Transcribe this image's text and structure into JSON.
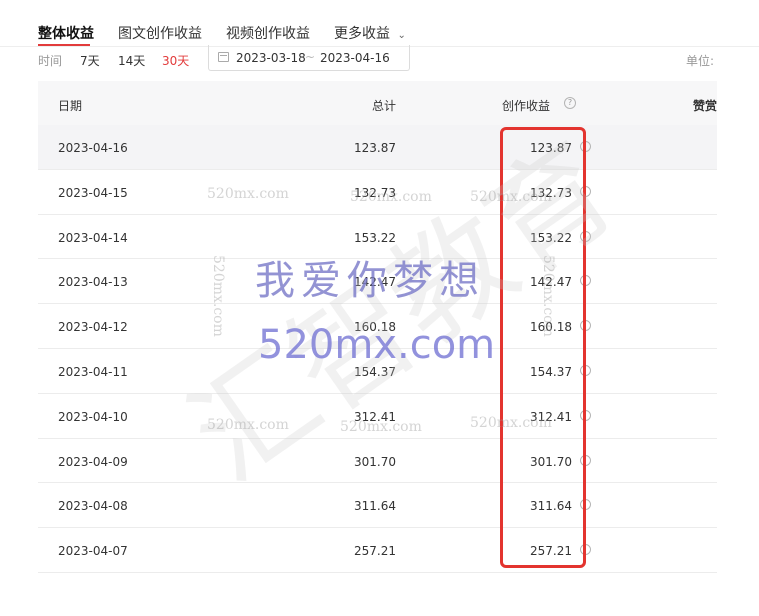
{
  "tabs": [
    {
      "label": "整体收益",
      "active": true
    },
    {
      "label": "图文创作收益",
      "active": false
    },
    {
      "label": "视频创作收益",
      "active": false
    },
    {
      "label": "更多收益",
      "active": false
    }
  ],
  "filter": {
    "label": "时间",
    "options": [
      "7天",
      "14天",
      "30天"
    ],
    "active_option": "30天",
    "date_start": "2023-03-18",
    "date_separator": "~",
    "date_end": "2023-04-16",
    "unit_label": "单位:"
  },
  "table": {
    "headers": {
      "date": "日期",
      "total": "总计",
      "earnings": "创作收益",
      "likes": "赞赏"
    },
    "rows": [
      {
        "date": "2023-04-16",
        "total": "123.87",
        "earnings": "123.87"
      },
      {
        "date": "2023-04-15",
        "total": "132.73",
        "earnings": "132.73"
      },
      {
        "date": "2023-04-14",
        "total": "153.22",
        "earnings": "153.22"
      },
      {
        "date": "2023-04-13",
        "total": "142.47",
        "earnings": "142.47"
      },
      {
        "date": "2023-04-12",
        "total": "160.18",
        "earnings": "160.18"
      },
      {
        "date": "2023-04-11",
        "total": "154.37",
        "earnings": "154.37"
      },
      {
        "date": "2023-04-10",
        "total": "312.41",
        "earnings": "312.41"
      },
      {
        "date": "2023-04-09",
        "total": "301.70",
        "earnings": "301.70"
      },
      {
        "date": "2023-04-08",
        "total": "311.64",
        "earnings": "311.64"
      },
      {
        "date": "2023-04-07",
        "total": "257.21",
        "earnings": "257.21"
      }
    ]
  },
  "watermark": {
    "cn": "我爱你梦想",
    "domain_big": "520mx.com",
    "domain_small": "520mx.com",
    "ghost": "汇智教育"
  },
  "colors": {
    "accent": "#e23b3b",
    "highlight_box": "#e3342f"
  }
}
